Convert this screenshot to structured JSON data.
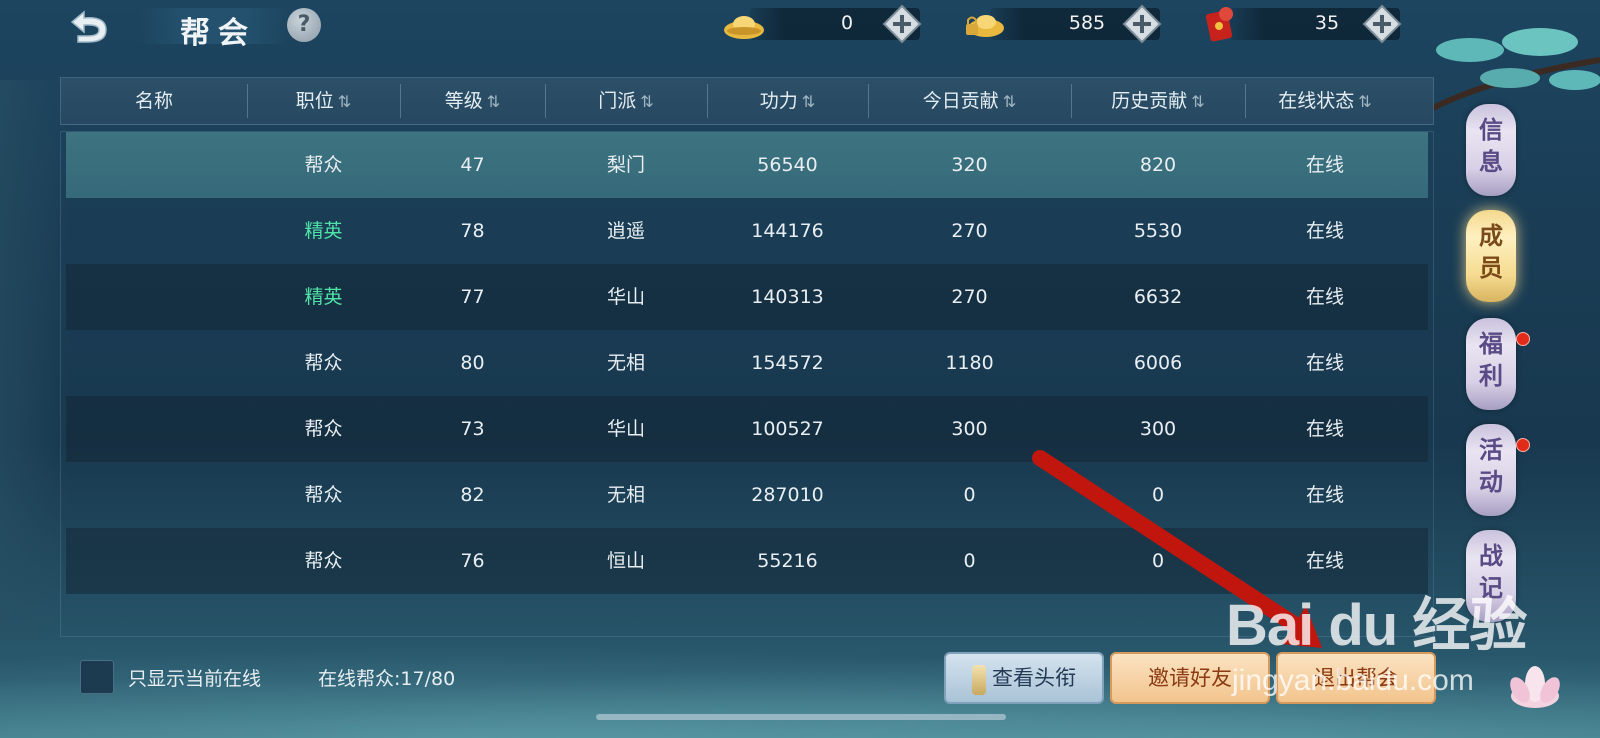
{
  "header": {
    "title": "帮会",
    "help": "?",
    "currencies": [
      {
        "icon": "gold-ingot-icon",
        "value": "0"
      },
      {
        "icon": "locked-ingot-icon",
        "value": "585"
      },
      {
        "icon": "red-envelope-icon",
        "value": "35"
      }
    ]
  },
  "table": {
    "columns": [
      {
        "label": "名称",
        "sort": ""
      },
      {
        "label": "职位",
        "sort": "⇅"
      },
      {
        "label": "等级",
        "sort": "⇅"
      },
      {
        "label": "门派",
        "sort": "⇅"
      },
      {
        "label": "功力",
        "sort": "⇅"
      },
      {
        "label": "今日贡献",
        "sort": "⇅"
      },
      {
        "label": "历史贡献",
        "sort": "⇅"
      },
      {
        "label": "在线状态",
        "sort": "⇅"
      }
    ],
    "rows": [
      {
        "name": "",
        "position": "帮众",
        "level": "47",
        "school": "梨门",
        "power": "56540",
        "today": "320",
        "history": "820",
        "status": "在线",
        "elite": false
      },
      {
        "name": "",
        "position": "精英",
        "level": "78",
        "school": "逍遥",
        "power": "144176",
        "today": "270",
        "history": "5530",
        "status": "在线",
        "elite": true
      },
      {
        "name": "",
        "position": "精英",
        "level": "77",
        "school": "华山",
        "power": "140313",
        "today": "270",
        "history": "6632",
        "status": "在线",
        "elite": true
      },
      {
        "name": "",
        "position": "帮众",
        "level": "80",
        "school": "无相",
        "power": "154572",
        "today": "1180",
        "history": "6006",
        "status": "在线",
        "elite": false
      },
      {
        "name": "",
        "position": "帮众",
        "level": "73",
        "school": "华山",
        "power": "100527",
        "today": "300",
        "history": "300",
        "status": "在线",
        "elite": false
      },
      {
        "name": "",
        "position": "帮众",
        "level": "82",
        "school": "无相",
        "power": "287010",
        "today": "0",
        "history": "0",
        "status": "在线",
        "elite": false
      },
      {
        "name": "",
        "position": "帮众",
        "level": "76",
        "school": "恒山",
        "power": "55216",
        "today": "0",
        "history": "0",
        "status": "在线",
        "elite": false
      }
    ]
  },
  "side_tabs": [
    {
      "label": "信息",
      "active": false,
      "badge": false
    },
    {
      "label": "成员",
      "active": true,
      "badge": false
    },
    {
      "label": "福利",
      "active": false,
      "badge": true
    },
    {
      "label": "活动",
      "active": false,
      "badge": true
    },
    {
      "label": "战记",
      "active": false,
      "badge": false
    }
  ],
  "footer": {
    "only_online_label": "只显示当前在线",
    "online_members_label": "在线帮众:17/80",
    "view_title_btn": "查看头衔",
    "invite_friends_btn": "邀请好友",
    "leave_guild_btn": "退出帮会"
  },
  "watermark": {
    "logo": "Bai du 经验",
    "url": "jingyan.baidu.com"
  },
  "colors": {
    "elite": "#4fe3a8",
    "selected_row": "#3d7480",
    "badge": "#e02a1a",
    "arrow": "#c0160e"
  }
}
